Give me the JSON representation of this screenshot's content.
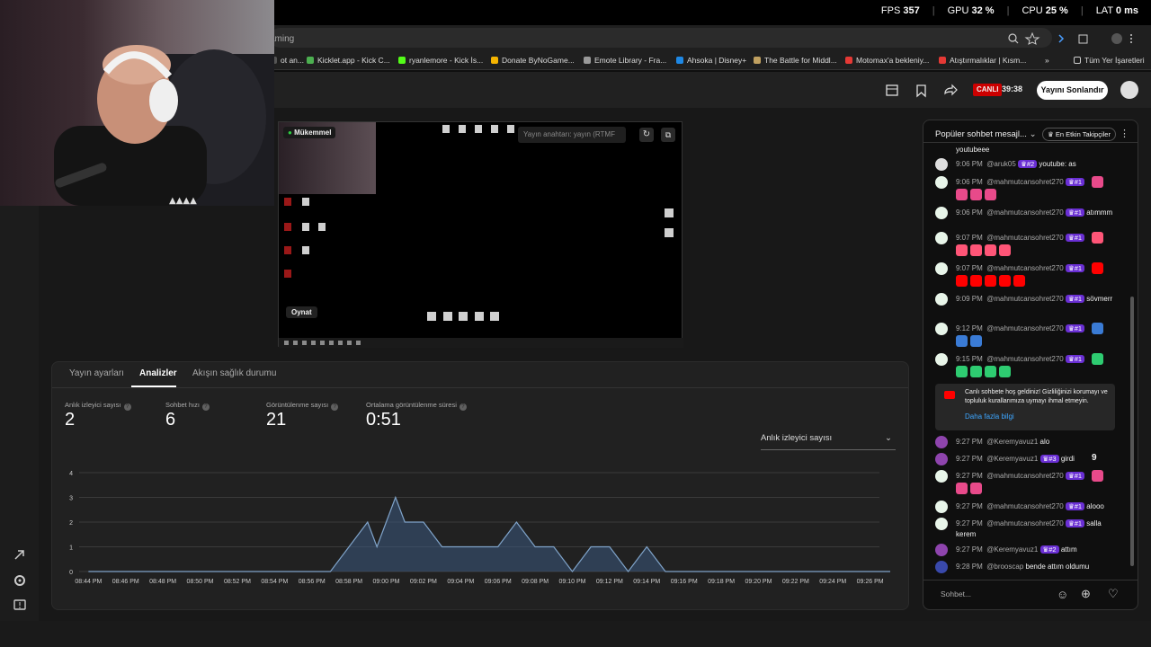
{
  "overlay": {
    "fps_label": "FPS",
    "fps": "357",
    "gpu_label": "GPU",
    "gpu": "32 %",
    "cpu_label": "CPU",
    "cpu": "25 %",
    "lat_label": "LAT",
    "lat": "0 ms"
  },
  "browser": {
    "address_text": "aming"
  },
  "bookmarks": [
    {
      "label": "ot an...",
      "color": "#555"
    },
    {
      "label": "Kicklet.app - Kick C...",
      "color": "#4caf50"
    },
    {
      "label": "ryanlemore - Kick İs...",
      "color": "#53fc18"
    },
    {
      "label": "Donate ByNoGame...",
      "color": "#f5b400"
    },
    {
      "label": "Emote Library - Fra...",
      "color": "#999"
    },
    {
      "label": "Ahsoka | Disney+",
      "color": "#1e88e5"
    },
    {
      "label": "The Battle for Middl...",
      "color": "#c0a060"
    },
    {
      "label": "Motomax'a bekleniy...",
      "color": "#e53935"
    },
    {
      "label": "Atıştırmalıklar | Kısm...",
      "color": "#e53935"
    }
  ],
  "bookmarks_all": "Tüm Yer İşaretleri",
  "header": {
    "live": "CANLI",
    "duration": "39:38",
    "end_button": "Yayını Sonlandır"
  },
  "preview": {
    "status": "Mükemmel",
    "key_placeholder": "Yayın anahtarı: yayın (RTMF",
    "play_label": "Oynat"
  },
  "tabs": [
    {
      "label": "Yayın ayarları"
    },
    {
      "label": "Analizler"
    },
    {
      "label": "Akışın sağlık durumu"
    }
  ],
  "stats": [
    {
      "label": "Anlık izleyici sayısı",
      "value": "2"
    },
    {
      "label": "Sohbet hızı",
      "value": "6"
    },
    {
      "label": "Görüntülenme sayısı",
      "value": "21"
    },
    {
      "label": "Ortalama görüntülenme süresi",
      "value": "0:51"
    }
  ],
  "dropdown": {
    "value": "Anlık izleyici sayısı"
  },
  "chart_data": {
    "type": "area",
    "x": [
      "08:44 PM",
      "08:46 PM",
      "08:48 PM",
      "08:50 PM",
      "08:52 PM",
      "08:54 PM",
      "08:56 PM",
      "08:58 PM",
      "09:00 PM",
      "09:02 PM",
      "09:04 PM",
      "09:06 PM",
      "09:08 PM",
      "09:10 PM",
      "09:12 PM",
      "09:14 PM",
      "09:16 PM",
      "09:18 PM",
      "09:20 PM",
      "09:22 PM",
      "09:24 PM",
      "09:26 PM"
    ],
    "points": [
      [
        0,
        0
      ],
      [
        13,
        0
      ],
      [
        14,
        1
      ],
      [
        15,
        2
      ],
      [
        15.5,
        1
      ],
      [
        16,
        2
      ],
      [
        16.5,
        3
      ],
      [
        17,
        2
      ],
      [
        18,
        2
      ],
      [
        19,
        1
      ],
      [
        22,
        1
      ],
      [
        23,
        2
      ],
      [
        24,
        1
      ],
      [
        25,
        1
      ],
      [
        26,
        0
      ],
      [
        27,
        1
      ],
      [
        28,
        1
      ],
      [
        29,
        0
      ],
      [
        30,
        1
      ],
      [
        31,
        0
      ],
      [
        45,
        0
      ],
      [
        46,
        2
      ]
    ],
    "y_ticks": [
      0,
      1,
      2,
      3,
      4
    ],
    "ylim": [
      0,
      4
    ],
    "grid": true,
    "color": "#3d5a80"
  },
  "chat": {
    "title": "Popüler sohbet mesajl...",
    "top_fans": "En Etkin Takipçiler",
    "first_line": "youtubeee",
    "messages": [
      {
        "time": "9:06 PM",
        "user": "@aruk05",
        "badge": "#2",
        "text": "youtube: as",
        "avatar": "#ddd"
      },
      {
        "time": "9:06 PM",
        "user": "@mahmutcansohret270",
        "badge": "#1",
        "text": "",
        "avatar": "#e8f5e9"
      },
      {
        "time": "9:06 PM",
        "user": "@mahmutcansohret270",
        "badge": "#1",
        "text": "atımmm",
        "avatar": "#e8f5e9"
      },
      {
        "time": "9:07 PM",
        "user": "@mahmutcansohret270",
        "badge": "#1",
        "text": "",
        "avatar": "#e8f5e9"
      },
      {
        "time": "9:07 PM",
        "user": "@mahmutcansohret270",
        "badge": "#1",
        "text": "",
        "avatar": "#e8f5e9"
      },
      {
        "time": "9:09 PM",
        "user": "@mahmutcansohret270",
        "badge": "#1",
        "text": "sövmerr",
        "avatar": "#e8f5e9"
      },
      {
        "time": "9:12 PM",
        "user": "@mahmutcansohret270",
        "badge": "#1",
        "text": "",
        "avatar": "#e8f5e9"
      },
      {
        "time": "9:15 PM",
        "user": "@mahmutcansohret270",
        "badge": "#1",
        "text": "",
        "avatar": "#e8f5e9"
      }
    ],
    "notice": "Canlı sohbete hoş geldiniz! Gizliliğinizi korumayı ve topluluk kurallarımıza uymayı ihmal etmeyin.",
    "notice_link": "Daha fazla bilgi",
    "messages2": [
      {
        "time": "9:27 PM",
        "user": "@Keremyavuz1",
        "badge": "",
        "text": "alo",
        "avatar": "#8e44ad"
      },
      {
        "time": "9:27 PM",
        "user": "@Keremyavuz1",
        "badge": "#3",
        "text": "girdi",
        "avatar": "#8e44ad"
      },
      {
        "time": "9:27 PM",
        "user": "@mahmutcansohret270",
        "badge": "#1",
        "text": "",
        "avatar": "#e8f5e9"
      },
      {
        "time": "9:27 PM",
        "user": "@mahmutcansohret270",
        "badge": "#1",
        "text": "alooo",
        "avatar": "#e8f5e9"
      },
      {
        "time": "9:27 PM",
        "user": "@mahmutcansohret270",
        "badge": "#1",
        "text": "salla",
        "avatar": "#e8f5e9"
      },
      {
        "time": "9:27 PM",
        "user": "@Keremyavuz1",
        "badge": "#2",
        "text": "attım",
        "avatar": "#8e44ad"
      },
      {
        "time": "9:28 PM",
        "user": "@brooscap",
        "badge": "",
        "text": "bende attım oldumu",
        "avatar": "#3949ab"
      }
    ],
    "kerem_line": "kerem",
    "girdi_count": "9",
    "input_placeholder": "Sohbet..."
  }
}
